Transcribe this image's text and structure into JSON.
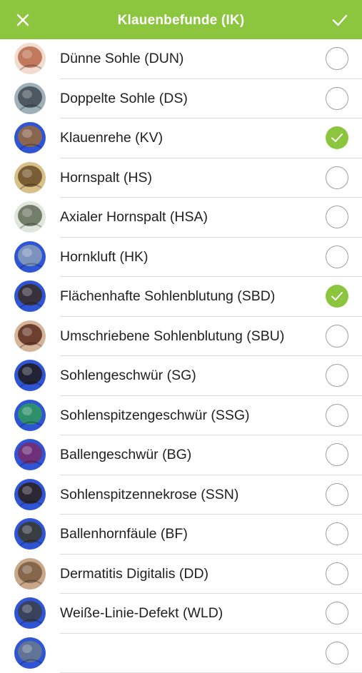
{
  "header": {
    "title": "Klauenbefunde (IK)",
    "close_icon": "close-icon",
    "confirm_icon": "checkmark-icon"
  },
  "colors": {
    "accent": "#8cc63f"
  },
  "items": [
    {
      "label": "Dünne Sohle (DUN)",
      "checked": false,
      "c1": "#b8684a",
      "c2": "#f2dcd0"
    },
    {
      "label": "Doppelte Sohle (DS)",
      "checked": false,
      "c1": "#3d4a52",
      "c2": "#9fb0b8"
    },
    {
      "label": "Klauenrehe (KV)",
      "checked": true,
      "c1": "#9a6a38",
      "c2": "#2f55d4"
    },
    {
      "label": "Hornspalt (HS)",
      "checked": false,
      "c1": "#6a4a26",
      "c2": "#d8c08a"
    },
    {
      "label": "Axialer Hornspalt (HSA)",
      "checked": false,
      "c1": "#5f6a55",
      "c2": "#e0e6dc"
    },
    {
      "label": "Hornkluft (HK)",
      "checked": false,
      "c1": "#8aa0b8",
      "c2": "#2f55d4"
    },
    {
      "label": "Flächenhafte Sohlenblutung (SBD)",
      "checked": true,
      "c1": "#3a2a20",
      "c2": "#2f55d4"
    },
    {
      "label": "Umschriebene Sohlenblutung (SBU)",
      "checked": false,
      "c1": "#5a2a1c",
      "c2": "#d6b49a"
    },
    {
      "label": "Sohlengeschwür (SG)",
      "checked": false,
      "c1": "#1e1a18",
      "c2": "#2f55d4"
    },
    {
      "label": "Sohlenspitzengeschwür (SSG)",
      "checked": false,
      "c1": "#2e9a5a",
      "c2": "#2f55d4"
    },
    {
      "label": "Ballengeschwür (BG)",
      "checked": false,
      "c1": "#7a2a6a",
      "c2": "#2f55d4"
    },
    {
      "label": "Sohlenspitzennekrose (SSN)",
      "checked": false,
      "c1": "#2a2018",
      "c2": "#2f55d4"
    },
    {
      "label": "Ballenhornfäule (BF)",
      "checked": false,
      "c1": "#3a3a2a",
      "c2": "#2f55d4"
    },
    {
      "label": "Dermatitis Digitalis (DD)",
      "checked": false,
      "c1": "#7a5a42",
      "c2": "#c8a888"
    },
    {
      "label": "Weiße-Linie-Defekt (WLD)",
      "checked": false,
      "c1": "#3a4048",
      "c2": "#2f55d4"
    },
    {
      "label": "",
      "checked": false,
      "c1": "#6a7a8a",
      "c2": "#2f55d4"
    }
  ]
}
